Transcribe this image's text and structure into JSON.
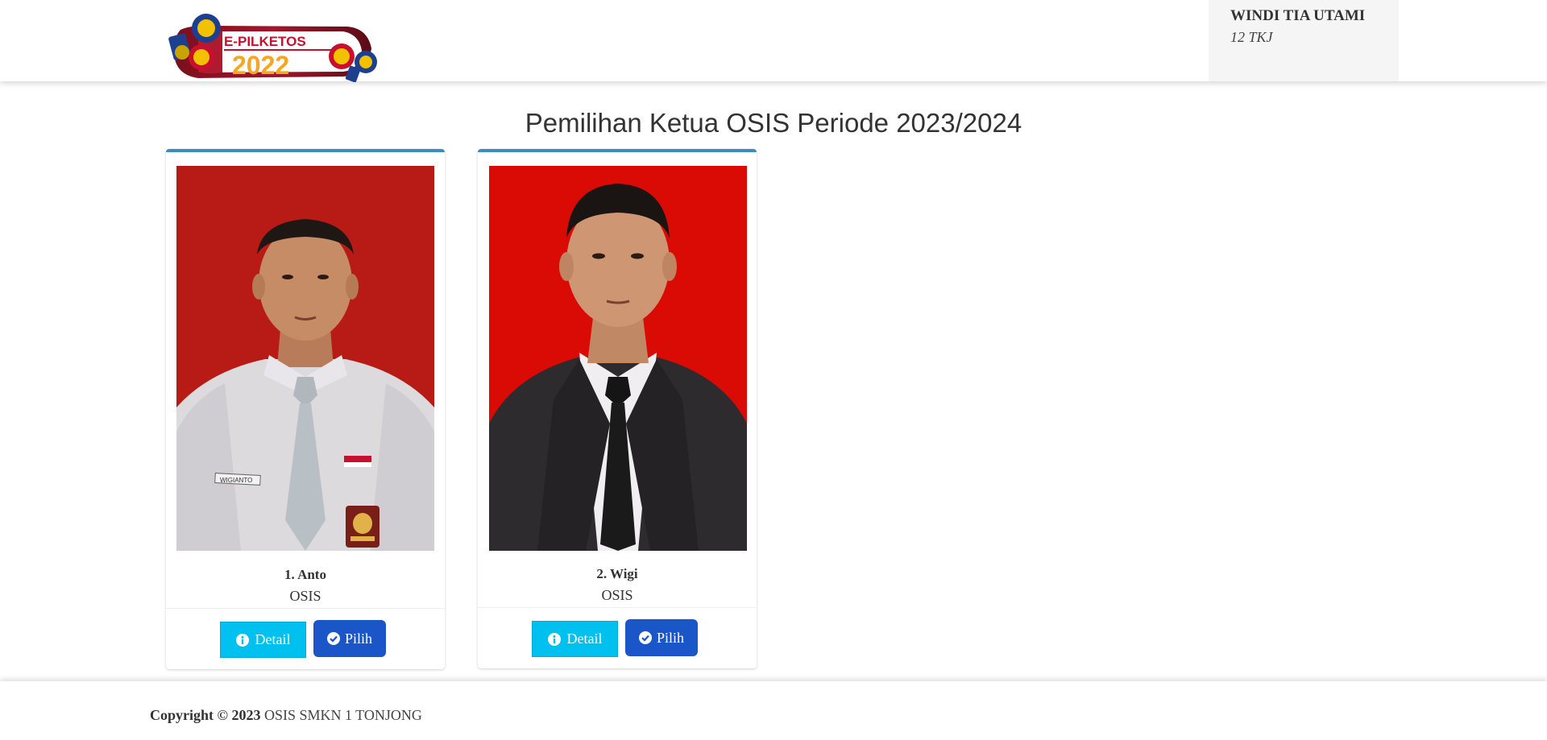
{
  "app": {
    "logo_label": "E-PILKETOS",
    "logo_year": "2022"
  },
  "user": {
    "name": "WINDI TIA UTAMI",
    "class": "12 TKJ"
  },
  "page": {
    "title": "Pemilihan Ketua OSIS Periode 2023/2024"
  },
  "candidates": [
    {
      "name": "1. Anto",
      "org": "OSIS",
      "detail_label": "Detail",
      "pilih_label": "Pilih",
      "name_tag": "WIGIANTO"
    },
    {
      "name": "2. Wigi",
      "org": "OSIS",
      "detail_label": "Detail",
      "pilih_label": "Pilih"
    }
  ],
  "footer": {
    "copyright_label": "Copyright © 2023",
    "org_name": "OSIS SMKN 1 TONJONG"
  },
  "colors": {
    "card_border": "#3c8dbc",
    "detail_button": "#00c0ef",
    "pilih_button": "#1b56c9",
    "photo_bg_1": "#b81b16",
    "photo_bg_2": "#d90b04"
  },
  "icons": {
    "detail": "info-circle-icon",
    "pilih": "check-circle-icon"
  }
}
